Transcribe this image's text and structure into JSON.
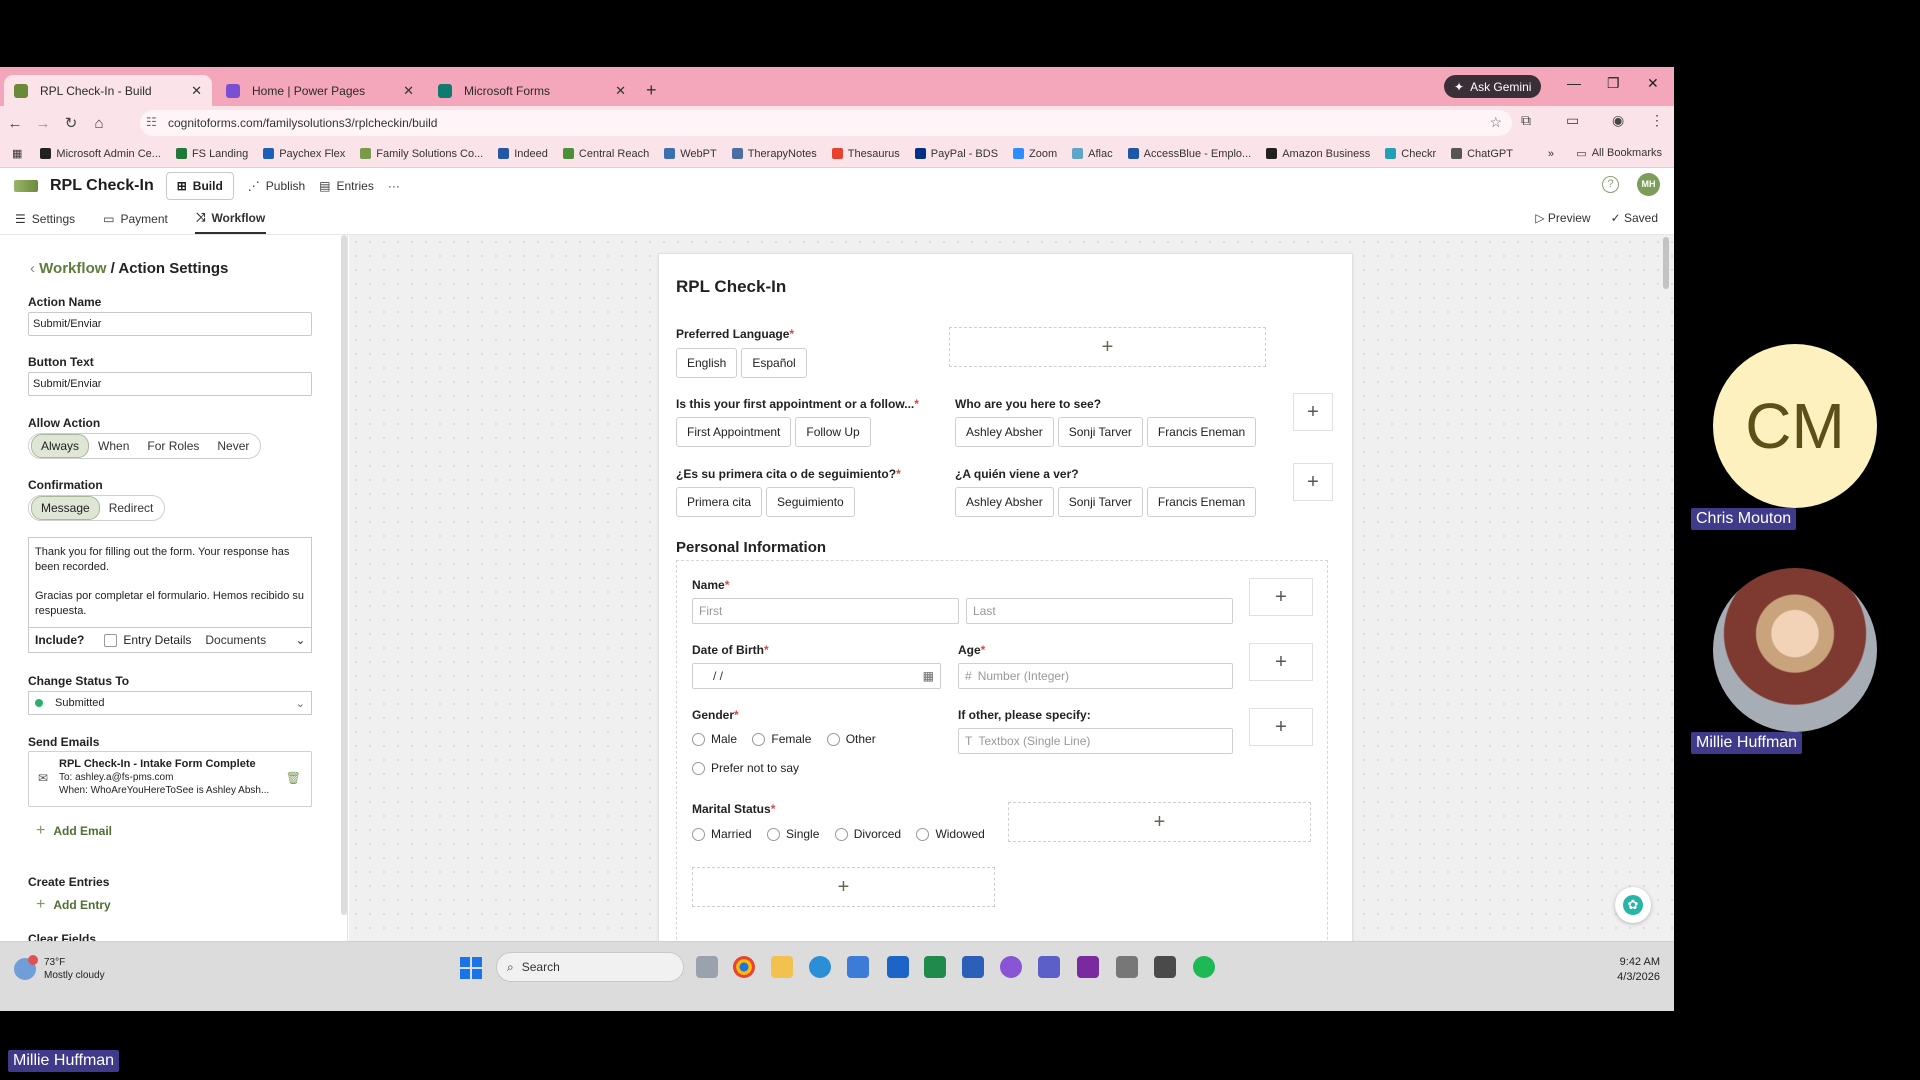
{
  "tabs": [
    {
      "title": "RPL Check-In - Build",
      "favicon_color": "#6a8a3a"
    },
    {
      "title": "Home | Power Pages",
      "favicon_color": "#7b4fd1"
    },
    {
      "title": "Microsoft Forms",
      "favicon_color": "#0f7b6c"
    }
  ],
  "browser": {
    "gemini_label": "Ask Gemini",
    "url": "cognitoforms.com/familysolutions3/rplcheckin/build",
    "all_bookmarks": "All Bookmarks"
  },
  "bookmarks": [
    {
      "label": "Microsoft Admin Ce...",
      "color": "#222"
    },
    {
      "label": "FS Landing",
      "color": "#1f7a3a"
    },
    {
      "label": "Paychex Flex",
      "color": "#1c5fb8"
    },
    {
      "label": "Family Solutions Co...",
      "color": "#7a9a4a"
    },
    {
      "label": "Indeed",
      "color": "#2557a7"
    },
    {
      "label": "Central Reach",
      "color": "#4a8f3a"
    },
    {
      "label": "WebPT",
      "color": "#3a6fb0"
    },
    {
      "label": "TherapyNotes",
      "color": "#4a6fa5"
    },
    {
      "label": "Thesaurus",
      "color": "#e8412d"
    },
    {
      "label": "PayPal - BDS",
      "color": "#003087"
    },
    {
      "label": "Zoom",
      "color": "#2d8cff"
    },
    {
      "label": "Aflac",
      "color": "#5ca6c8"
    },
    {
      "label": "AccessBlue - Emplo...",
      "color": "#1d57a8"
    },
    {
      "label": "Amazon Business",
      "color": "#222"
    },
    {
      "label": "Checkr",
      "color": "#21a0b8"
    },
    {
      "label": "ChatGPT",
      "color": "#555"
    }
  ],
  "app": {
    "form_title": "RPL Check-In",
    "build": "Build",
    "publish": "Publish",
    "entries": "Entries",
    "more": "···",
    "avatar": "MH",
    "settings": "Settings",
    "payment": "Payment",
    "workflow": "Workflow",
    "preview": "Preview",
    "saved": "Saved"
  },
  "panel": {
    "crumb_root": "Workflow",
    "crumb_sep": "/",
    "crumb_current": "Action Settings",
    "action_name_label": "Action Name",
    "action_name": "Submit/Enviar",
    "button_text_label": "Button Text",
    "button_text": "Submit/Enviar",
    "allow_action_label": "Allow Action",
    "allow_options": [
      "Always",
      "When",
      "For Roles",
      "Never"
    ],
    "confirmation_label": "Confirmation",
    "confirmation_options": [
      "Message",
      "Redirect"
    ],
    "message_en": "Thank you for filling out the form. Your response has been recorded.",
    "message_es": "Gracias por completar el formulario. Hemos recibido su respuesta.",
    "include_label": "Include?",
    "entry_details": "Entry Details",
    "documents": "Documents",
    "change_status_label": "Change Status To",
    "status": "Submitted",
    "send_emails_label": "Send Emails",
    "email_title": "RPL Check-In - Intake Form Complete",
    "email_to": "To: ashley.a@fs-pms.com",
    "email_when": "When: WhoAreYouHereToSee is Ashley Absh...",
    "add_email": "Add Email",
    "create_entries_label": "Create Entries",
    "add_entry": "Add Entry",
    "clear_fields_label": "Clear Fields"
  },
  "form": {
    "title": "RPL Check-In",
    "preferred_language": "Preferred Language",
    "lang_options": [
      "English",
      "Español"
    ],
    "first_appt_q": "Is this your first appointment or a follow...",
    "appt_options": [
      "First Appointment",
      "Follow Up"
    ],
    "who_q": "Who are you here to see?",
    "who_options": [
      "Ashley Absher",
      "Sonji Tarver",
      "Francis Eneman"
    ],
    "first_appt_q_es": "¿Es su primera cita o de seguimiento?",
    "appt_options_es": [
      "Primera cita",
      "Seguimiento"
    ],
    "who_q_es": "¿A quién viene a ver?",
    "who_options_es": [
      "Ashley Absher",
      "Sonji Tarver",
      "Francis Eneman"
    ],
    "section_title": "Personal Information",
    "name_label": "Name",
    "first_ph": "First",
    "last_ph": "Last",
    "dob_label": "Date of Birth",
    "dob_ph": "/   /",
    "age_label": "Age",
    "age_ph": "Number (Integer)",
    "gender_label": "Gender",
    "gender_options": [
      "Male",
      "Female",
      "Other"
    ],
    "gender_extra": "Prefer not to say",
    "other_label": "If other, please specify:",
    "other_ph": "Textbox (Single Line)",
    "marital_label": "Marital Status",
    "marital_options": [
      "Married",
      "Single",
      "Divorced",
      "Widowed"
    ]
  },
  "taskbar": {
    "temp": "73°F",
    "weather": "Mostly cloudy",
    "search": "Search",
    "time": "9:42 AM",
    "date": "4/3/2026"
  },
  "meeting": {
    "cm_initials": "CM",
    "cm_name": "Chris Mouton",
    "mh_name": "Millie Huffman",
    "self_name": "Millie Huffman"
  }
}
